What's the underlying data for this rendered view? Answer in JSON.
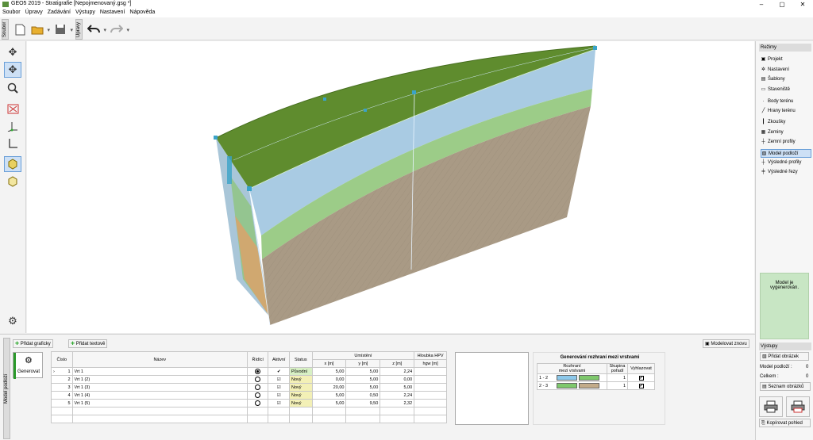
{
  "window": {
    "title": "GEO5 2019 - Stratigrafie [Nepojmenovaný.gsg *]",
    "minimize": "–",
    "maximize": "▢",
    "close": "✕"
  },
  "menu": [
    "Soubor",
    "Úpravy",
    "Zadávání",
    "Výstupy",
    "Nastavení",
    "Nápověda"
  ],
  "toolbar": {
    "group1_label": "Soubor",
    "group2_label": "Úpravy"
  },
  "right_panel": {
    "header": "Režimy",
    "items": [
      {
        "label": "Projekt",
        "icon": "project-icon",
        "glyph": "▣"
      },
      {
        "label": "Nastavení",
        "icon": "gear-icon",
        "glyph": "✲"
      },
      {
        "label": "Šablony",
        "icon": "template-icon",
        "glyph": "▤"
      },
      {
        "label": "Staveniště",
        "icon": "site-icon",
        "glyph": "▭"
      },
      {
        "label": "Body terénu",
        "icon": "terrain-points-icon",
        "glyph": "·"
      },
      {
        "label": "Hrany terénu",
        "icon": "terrain-edges-icon",
        "glyph": "╱"
      },
      {
        "label": "Zkoušky",
        "icon": "test-icon",
        "glyph": "┃"
      },
      {
        "label": "Zeminy",
        "icon": "soil-icon",
        "glyph": "▦"
      },
      {
        "label": "Zemní profily",
        "icon": "soil-profile-icon",
        "glyph": "┼"
      },
      {
        "label": "Model podloží",
        "icon": "subsoil-model-icon",
        "glyph": "▧"
      },
      {
        "label": "Výsledné profily",
        "icon": "result-profile-icon",
        "glyph": "┼"
      },
      {
        "label": "Výsledné řezy",
        "icon": "result-section-icon",
        "glyph": "╪"
      }
    ],
    "selected": 9,
    "message": "Model je vygenerován.",
    "outputs": {
      "header": "Výstupy",
      "add_picture": "Přidat obrázek",
      "subsoil_label": "Model podloží :",
      "subsoil_value": "0",
      "total_label": "Celkem :",
      "total_value": "0",
      "list_pictures": "Seznam obrázků",
      "copy_view": "Kopírovat pohled"
    }
  },
  "bottom": {
    "vertical_label": "Model podloží",
    "add_graphic": "Přidat graficky",
    "add_text": "Přidat textově",
    "generate": "Generovat",
    "remodel": "Modelovat znovu",
    "table": {
      "headers": {
        "no": "Číslo",
        "name": "Název",
        "ridici": "Řídící",
        "aktivni": "Aktivní",
        "status": "Status",
        "placement": "Umístění",
        "x": "x [m]",
        "y": "y [m]",
        "z": "z [m]",
        "hpv": "Hloubka HPV",
        "hpv_unit": "hgw [m]"
      },
      "rows": [
        {
          "no": "1",
          "name": "Vrt 1",
          "ridici": true,
          "aktivni": "✔",
          "status": "Původní",
          "x": "5,00",
          "y": "5,00",
          "z": "2,24",
          "hpv": ""
        },
        {
          "no": "2",
          "name": "Vrt 1 (2)",
          "ridici": false,
          "aktivni": "☑",
          "status": "Nový",
          "x": "0,00",
          "y": "5,00",
          "z": "0,00",
          "hpv": ""
        },
        {
          "no": "3",
          "name": "Vrt 1 (3)",
          "ridici": false,
          "aktivni": "☑",
          "status": "Nový",
          "x": "20,00",
          "y": "5,00",
          "z": "5,00",
          "hpv": ""
        },
        {
          "no": "4",
          "name": "Vrt 1 (4)",
          "ridici": false,
          "aktivni": "☑",
          "status": "Nový",
          "x": "5,00",
          "y": "0,50",
          "z": "2,24",
          "hpv": ""
        },
        {
          "no": "5",
          "name": "Vrt 1 (5)",
          "ridici": false,
          "aktivni": "☑",
          "status": "Nový",
          "x": "5,00",
          "y": "9,50",
          "z": "2,32",
          "hpv": ""
        }
      ]
    },
    "interfaces": {
      "title": "Generování rozhraní mezi vrstvami",
      "headers": {
        "col1": "Rozhraní",
        "col1b": "mezi vrstvami",
        "col2": "Skupina",
        "col2b": "pořadí",
        "col3": "Vyhlazovat"
      },
      "rows": [
        {
          "pair": "1 - 2",
          "c1": "#8cc8ea",
          "c2": "#7ec86c",
          "group": "1"
        },
        {
          "pair": "2 - 3",
          "c1": "#7ec86c",
          "c2": "#c2ab8a",
          "group": "1"
        }
      ]
    }
  },
  "colors": {
    "terrain": "#5f8c2e",
    "blue_layer": "#a8cce4",
    "green_layer": "#9ccc88",
    "soil": "#a99a85"
  }
}
